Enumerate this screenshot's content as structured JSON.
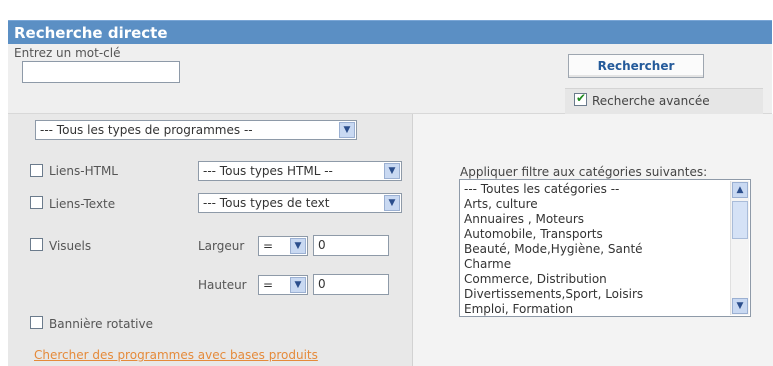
{
  "header": {
    "title": "Recherche directe"
  },
  "search": {
    "keyword_label": "Entrez un mot-clé",
    "keyword_value": "",
    "button_label": "Rechercher",
    "advanced_label": "Recherche avancée",
    "advanced_checked": true
  },
  "programs": {
    "type_select": "--- Tous les types de programmes --",
    "html_links_label": "Liens-HTML",
    "html_type_select": "--- Tous types HTML --",
    "text_links_label": "Liens-Texte",
    "text_type_select": "--- Tous types de text",
    "visuals_label": "Visuels",
    "width_label": "Largeur",
    "width_op": "=",
    "width_value": "0",
    "height_label": "Hauteur",
    "height_op": "=",
    "height_value": "0",
    "rotating_banner_label": "Bannière rotative",
    "products_link": "Chercher des programmes avec bases produits"
  },
  "filter": {
    "label": "Appliquer filtre aux catégories suivantes:",
    "categories": [
      "--- Toutes les catégories --",
      "Arts, culture",
      "Annuaires , Moteurs",
      "Automobile, Transports",
      "Beauté, Mode,Hygiène, Santé",
      "Charme",
      "Commerce, Distribution",
      "Divertissements,Sport, Loisirs",
      "Emploi, Formation"
    ]
  },
  "icons": {
    "dropdown": "chevron-down-icon",
    "checkbox_checked": "checkmark-icon",
    "scroll_up": "chevron-up-icon",
    "scroll_down": "chevron-down-icon"
  },
  "colors": {
    "header_bg": "#5b8fc4",
    "link": "#e58a3a",
    "button_text": "#245a9a"
  }
}
